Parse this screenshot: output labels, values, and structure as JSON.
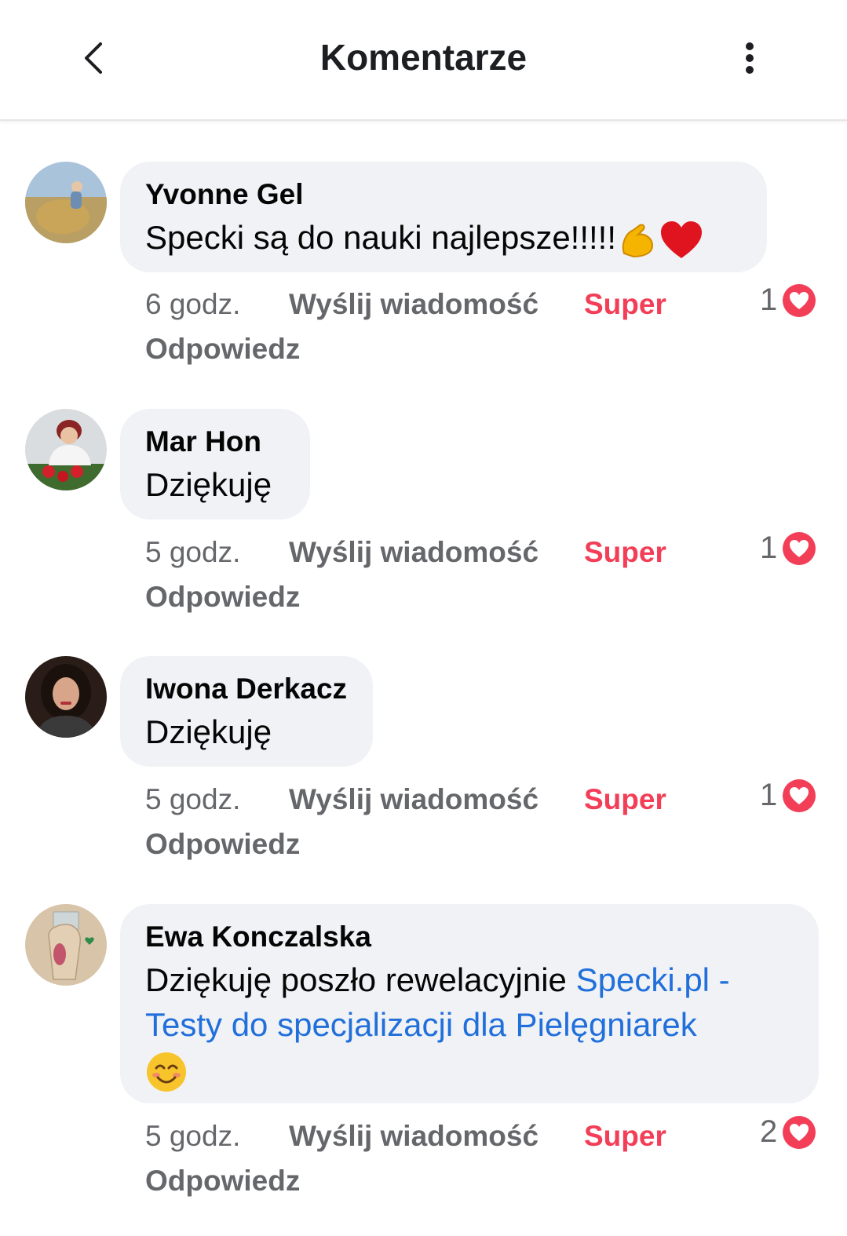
{
  "header": {
    "title": "Komentarze"
  },
  "colors": {
    "accent_super": "#f33e58",
    "link": "#216fdb",
    "bubble": "#f0f2f5",
    "meta": "#65676b"
  },
  "icons": {
    "back": "chevron-left-icon",
    "more": "more-vertical-icon",
    "reaction": "heart-reaction-icon"
  },
  "actions": {
    "message": "Wyślij wiadomość",
    "react": "Super",
    "reply": "Odpowiedz"
  },
  "comments": [
    {
      "author": "Yvonne Gel",
      "text": "Specki są do nauki najlepsze!!!!!",
      "emojis": [
        "flexed-biceps",
        "red-heart"
      ],
      "time": "6 godz.",
      "reactions": "1"
    },
    {
      "author": "Mar Hon",
      "text": "Dziękuję",
      "time": "5 godz.",
      "reactions": "1"
    },
    {
      "author": "Iwona Derkacz",
      "text": "Dziękuję",
      "time": "5 godz.",
      "reactions": "1"
    },
    {
      "author": "Ewa Konczalska",
      "text": "Dziękuję poszło rewelacyjnie ",
      "link": "Specki.pl - Testy do specjalizacji dla Pielęgniarek",
      "emojis": [
        "smiling-face"
      ],
      "time": "5 godz.",
      "reactions": "2"
    }
  ]
}
